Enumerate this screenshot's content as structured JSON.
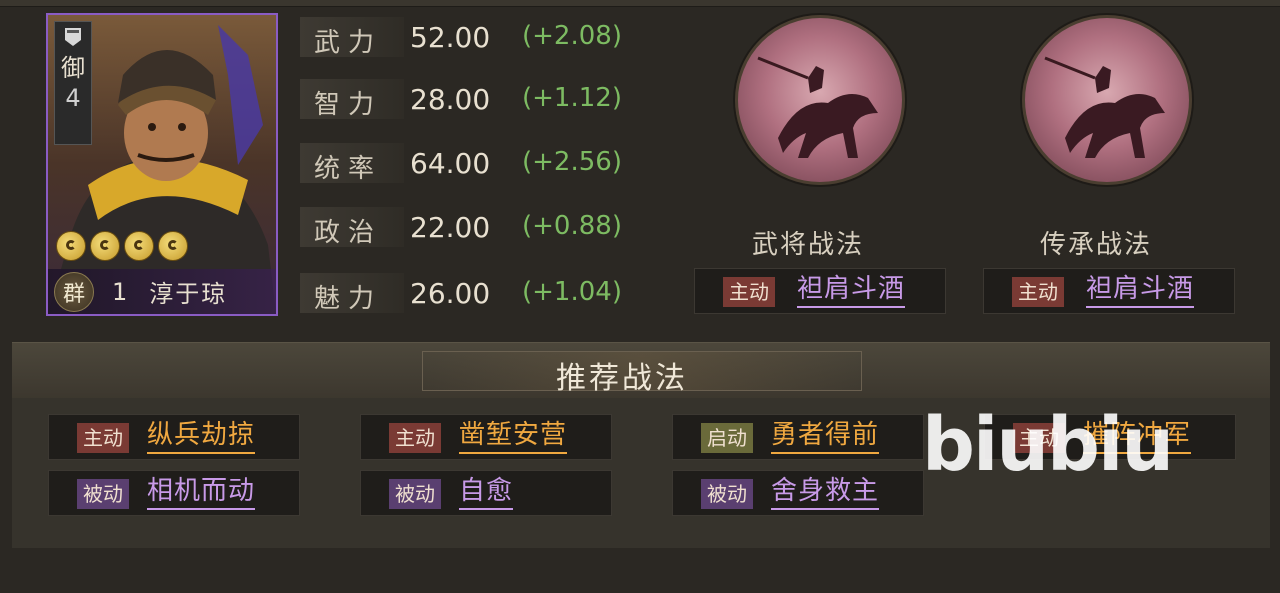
{
  "general": {
    "rank_char": "御",
    "rank_num": "4",
    "stars": 4,
    "faction": "群",
    "cost": "1",
    "name": "淳于琼"
  },
  "stats": [
    {
      "label": "武力",
      "value": "52.00",
      "bonus": "(+2.08)"
    },
    {
      "label": "智力",
      "value": "28.00",
      "bonus": "(+1.12)"
    },
    {
      "label": "统率",
      "value": "64.00",
      "bonus": "(+2.56)"
    },
    {
      "label": "政治",
      "value": "22.00",
      "bonus": "(+0.88)"
    },
    {
      "label": "魅力",
      "value": "26.00",
      "bonus": "(+1.04)"
    }
  ],
  "skills": {
    "general_skill": {
      "title": "武将战法",
      "tag": "主动",
      "name": "袒肩斗酒"
    },
    "inherit_skill": {
      "title": "传承战法",
      "tag": "主动",
      "name": "袒肩斗酒"
    }
  },
  "recommend": {
    "title": "推荐战法",
    "items": [
      {
        "tag": "主动",
        "name": "纵兵劫掠"
      },
      {
        "tag": "主动",
        "name": "凿堑安营"
      },
      {
        "tag": "启动",
        "name": "勇者得前"
      },
      {
        "tag": "主动",
        "name": "摧阵冲军"
      },
      {
        "tag": "被动",
        "name": "相机而动"
      },
      {
        "tag": "被动",
        "name": "自愈"
      },
      {
        "tag": "被动",
        "name": "舍身救主"
      }
    ]
  },
  "watermark": "biubiu",
  "colors": {
    "card_border": "#8a5cc4",
    "bonus_green": "#7dbb62",
    "active_tag": "#7a3a34",
    "passive_tag": "#5a3f70",
    "start_tag": "#6a6a3a",
    "skill_orange": "#f0a840",
    "skill_purple": "#c89ae8"
  }
}
